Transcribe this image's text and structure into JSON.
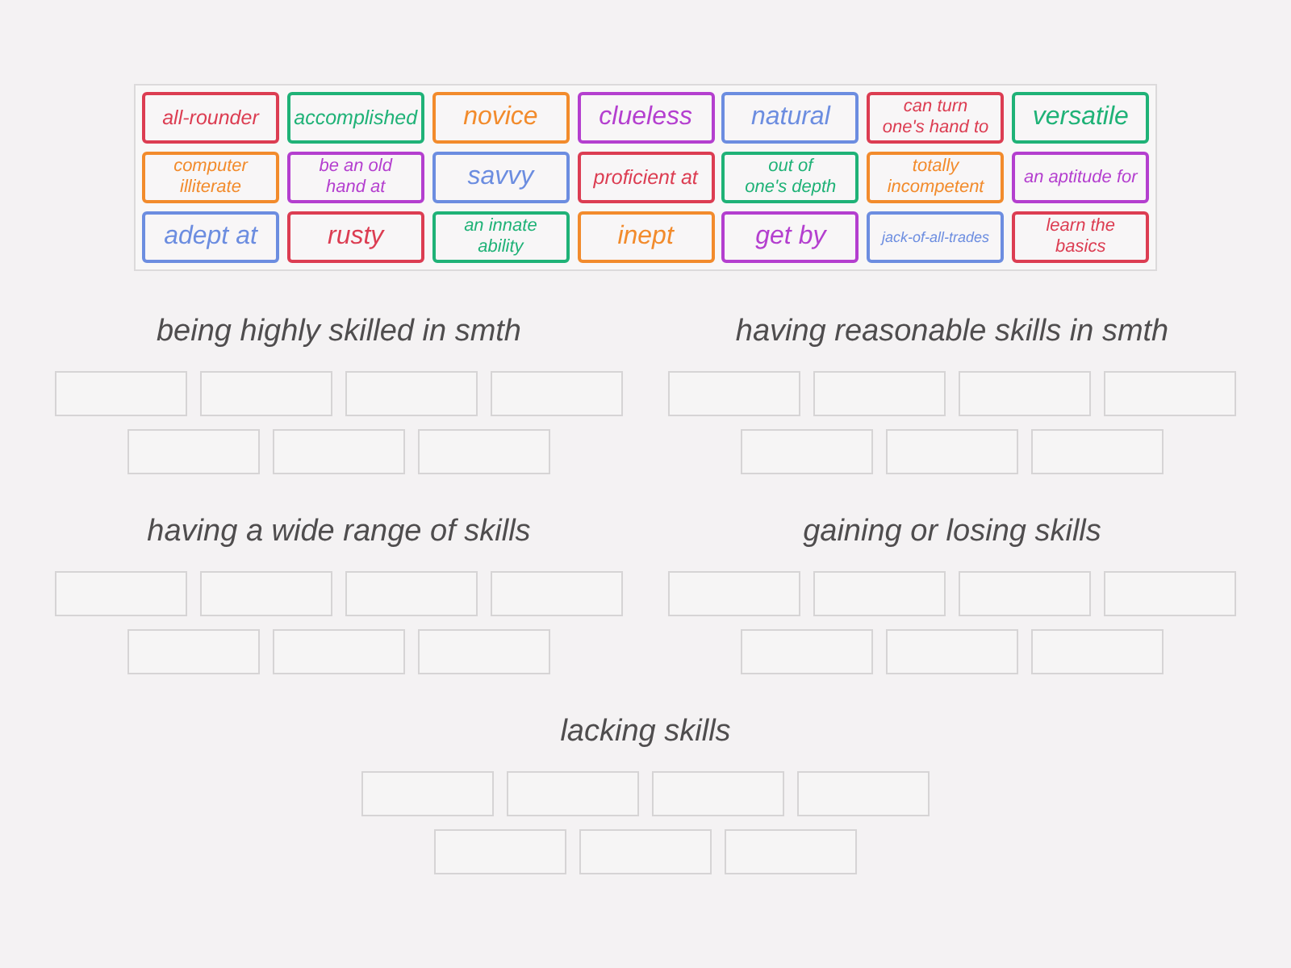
{
  "tiles": [
    {
      "text": "all-rounder",
      "color": "#dc3d52"
    },
    {
      "text": "accomplished",
      "color": "#1fb277"
    },
    {
      "text": "novice",
      "color": "#f28b2c"
    },
    {
      "text": "clueless",
      "color": "#b43fcf"
    },
    {
      "text": "natural",
      "color": "#6c8de0"
    },
    {
      "text": "can turn one's hand to",
      "color": "#dc3d52"
    },
    {
      "text": "versatile",
      "color": "#1fb277"
    },
    {
      "text": "computer illiterate",
      "color": "#f28b2c"
    },
    {
      "text": "be an old hand at",
      "color": "#b43fcf"
    },
    {
      "text": "savvy",
      "color": "#6c8de0"
    },
    {
      "text": "proficient at",
      "color": "#dc3d52"
    },
    {
      "text": "out of one's depth",
      "color": "#1fb277"
    },
    {
      "text": "totally incompetent",
      "color": "#f28b2c"
    },
    {
      "text": "an aptitude for",
      "color": "#b43fcf"
    },
    {
      "text": "adept at",
      "color": "#6c8de0"
    },
    {
      "text": "rusty",
      "color": "#dc3d52"
    },
    {
      "text": "an innate ability",
      "color": "#1fb277"
    },
    {
      "text": "inept",
      "color": "#f28b2c"
    },
    {
      "text": "get by",
      "color": "#b43fcf"
    },
    {
      "text": "jack-of-all-trades",
      "color": "#6c8de0"
    },
    {
      "text": "learn the basics",
      "color": "#dc3d52"
    }
  ],
  "groups": [
    {
      "title": "being highly skilled in smth",
      "slots": [
        {
          "filled": false
        },
        {
          "filled": false
        },
        {
          "filled": false
        },
        {
          "filled": false
        },
        {
          "filled": false
        },
        {
          "filled": false
        },
        {
          "filled": false
        }
      ]
    },
    {
      "title": "having reasonable skills in smth",
      "slots": [
        {
          "filled": false
        },
        {
          "filled": false
        },
        {
          "filled": false
        },
        {
          "filled": false
        },
        {
          "filled": false
        },
        {
          "filled": false
        },
        {
          "filled": false
        }
      ]
    },
    {
      "title": "having a wide range of skills",
      "slots": [
        {
          "filled": false
        },
        {
          "filled": false
        },
        {
          "filled": false
        },
        {
          "filled": false
        },
        {
          "filled": false
        },
        {
          "filled": false
        },
        {
          "filled": false
        }
      ]
    },
    {
      "title": "gaining or losing skills",
      "slots": [
        {
          "filled": false
        },
        {
          "filled": false
        },
        {
          "filled": false
        },
        {
          "filled": false
        },
        {
          "filled": false
        },
        {
          "filled": false
        },
        {
          "filled": false
        }
      ]
    },
    {
      "title": "lacking skills",
      "slots": [
        {
          "filled": false
        },
        {
          "filled": false
        },
        {
          "filled": false
        },
        {
          "filled": false
        },
        {
          "filled": false
        },
        {
          "filled": false
        },
        {
          "filled": false
        }
      ]
    }
  ]
}
